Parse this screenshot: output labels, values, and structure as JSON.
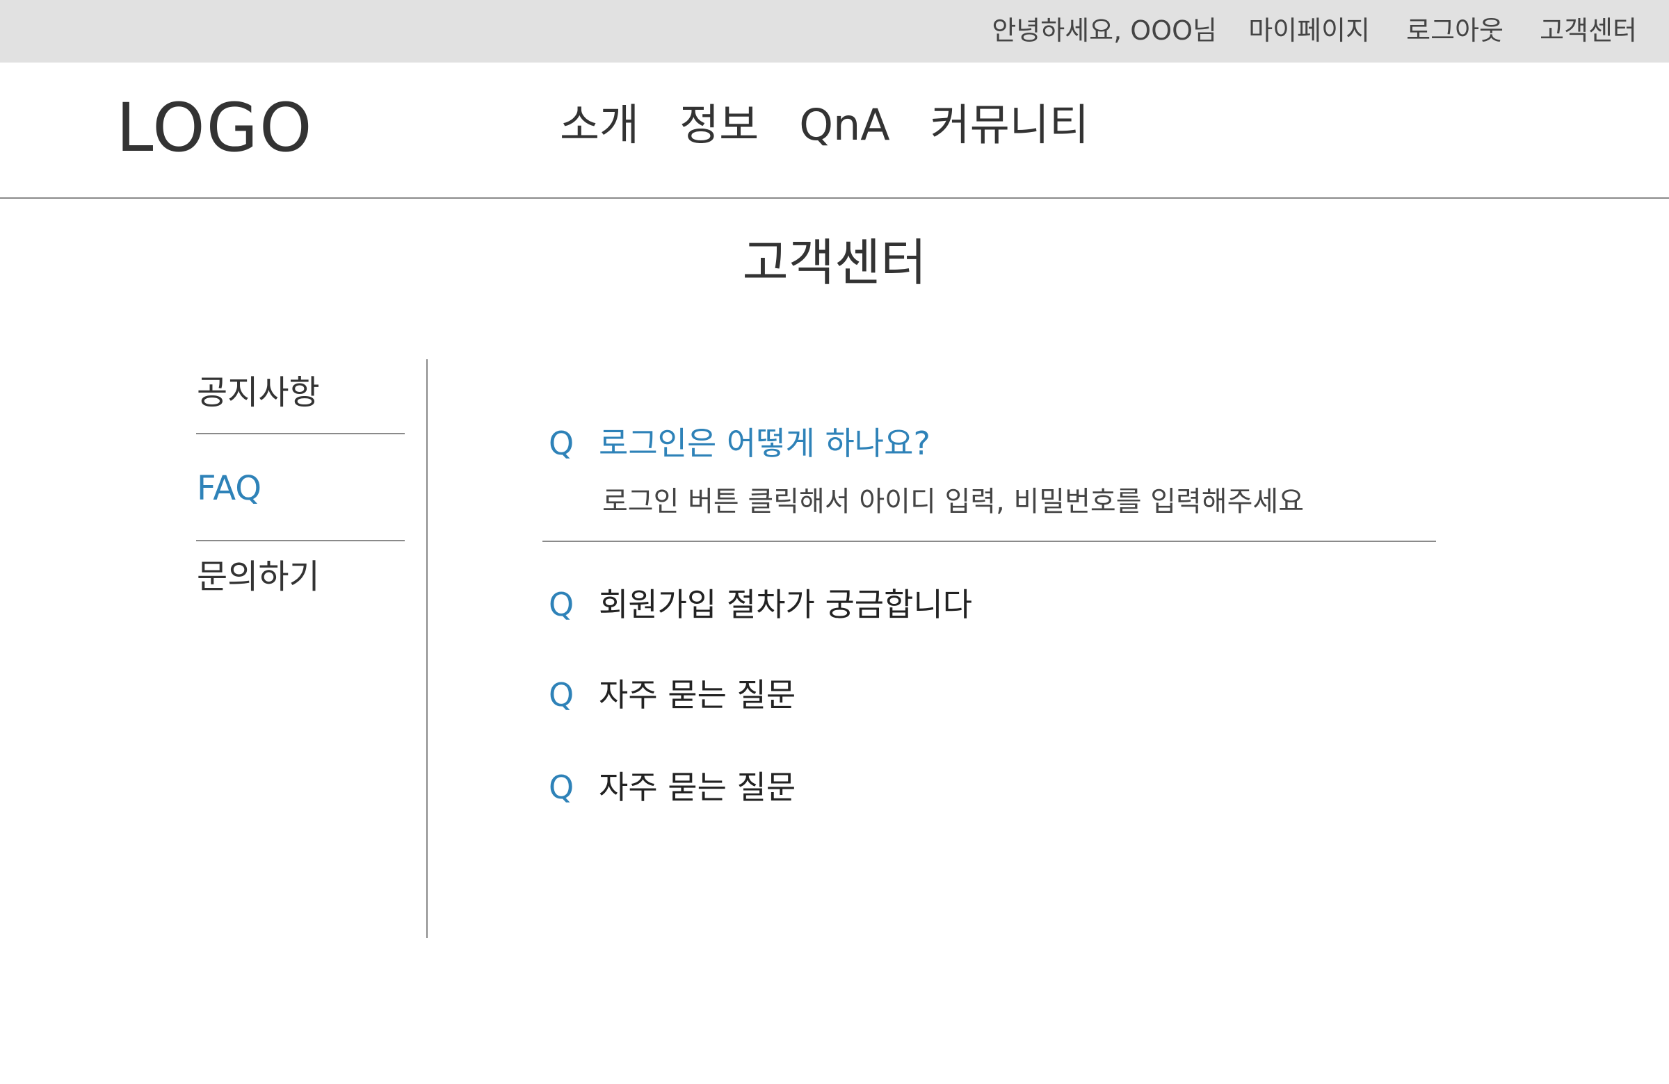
{
  "topbar": {
    "greeting": "안녕하세요, OOO님",
    "mypage": "마이페이지",
    "logout": "로그아웃",
    "support": "고객센터"
  },
  "header": {
    "logo": "LOGO",
    "nav": [
      "소개",
      "정보",
      "QnA",
      "커뮤니티"
    ]
  },
  "page_title": "고객센터",
  "side_menu": {
    "items": [
      "공지사항",
      "FAQ",
      "문의하기"
    ],
    "active": "FAQ"
  },
  "faq": {
    "q_marker": "Q",
    "items": [
      {
        "question": "로그인은 어떻게 하나요?",
        "answer": "로그인 버튼 클릭해서 아이디 입력, 비밀번호를 입력해주세요"
      },
      {
        "question": "회원가입 절차가 궁금합니다"
      },
      {
        "question": "자주 묻는 질문"
      },
      {
        "question": "자주 묻는 질문"
      }
    ]
  },
  "colors": {
    "accent": "#2e82b8",
    "topbar_bg": "#e1e1e1",
    "text": "#333333",
    "divider": "#8a8a8a"
  }
}
